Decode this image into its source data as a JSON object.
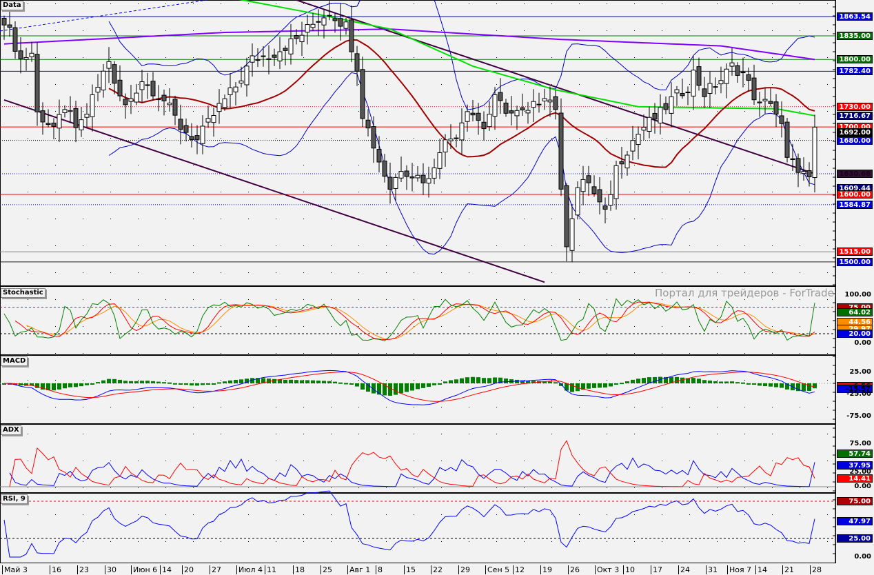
{
  "panels": {
    "main": "Data",
    "stochastic": "Stochastic",
    "macd": "MACD",
    "adx": "ADX",
    "rsi": "RSI, 9"
  },
  "watermark": "Портал для трейдеров - ForTrader.ru",
  "x_labels": [
    "Май 3",
    "16",
    "23",
    "30",
    "Июн 6",
    "14",
    "20",
    "27",
    "Июл 4",
    "11",
    "18",
    "25",
    "Авг 1",
    "8",
    "15",
    "22",
    "29",
    "Сен 5",
    "12",
    "19",
    "26",
    "Окт 3",
    "10",
    "17",
    "24",
    "31",
    "Ноя 7",
    "14",
    "21",
    "28"
  ],
  "price_levels": [
    {
      "label": "1863.54",
      "value": 1863.54,
      "bg": "#0000e0",
      "fg": "#ffffff",
      "line": "#0000e0",
      "style": "solid"
    },
    {
      "label": "1835.00",
      "value": 1835.0,
      "bg": "#007000",
      "fg": "#ffffff",
      "line": "#008000",
      "style": "solid"
    },
    {
      "label": "1800.00",
      "value": 1800.0,
      "bg": "#007000",
      "fg": "#ffffff",
      "line": "#008000",
      "style": "solid"
    },
    {
      "label": "1782.40",
      "value": 1782.4,
      "bg": "#0000e0",
      "fg": "#ffffff",
      "line": "#202040",
      "style": "solid"
    },
    {
      "label": "1730.00",
      "value": 1730.0,
      "bg": "#ff0000",
      "fg": "#ffffff",
      "line": "#ff0000",
      "style": "dotted"
    },
    {
      "label": "1716.67",
      "value": 1716.67,
      "bg": "#000080",
      "fg": "#ffffff",
      "line": null,
      "style": "none"
    },
    {
      "label": "1700.00",
      "value": 1700.0,
      "bg": "#ff0000",
      "fg": "#ffffff",
      "line": "#ff0000",
      "style": "solid"
    },
    {
      "label": "1692.00",
      "value": 1692.0,
      "bg": "#000000",
      "fg": "#ffffff",
      "line": null,
      "style": "none"
    },
    {
      "label": "1680.00",
      "value": 1680.0,
      "bg": "#0000e0",
      "fg": "#ffffff",
      "line": "#000000",
      "style": "dotted"
    },
    {
      "label": "1630.68",
      "value": 1630.68,
      "bg": "#301030",
      "fg": "#1a001a",
      "line": "#0000e0",
      "style": "dotted"
    },
    {
      "label": "1609.44",
      "value": 1609.44,
      "bg": "#000080",
      "fg": "#ffffff",
      "line": null,
      "style": "none"
    },
    {
      "label": "1600.00",
      "value": 1600.0,
      "bg": "#ff0000",
      "fg": "#ffffff",
      "line": "#ff0000",
      "style": "solid"
    },
    {
      "label": "1584.87",
      "value": 1584.87,
      "bg": "#0000e0",
      "fg": "#ffffff",
      "line": "#0000e0",
      "style": "dotted"
    },
    {
      "label": "1515.00",
      "value": 1515.0,
      "bg": "#ff0000",
      "fg": "#ffffff",
      "line": "#808080",
      "style": "solid"
    },
    {
      "label": "1500.00",
      "value": 1500.0,
      "bg": "#0000e0",
      "fg": "#ffffff",
      "line": "#202020",
      "style": "solid"
    }
  ],
  "stoch_labels": [
    {
      "label": "100.00",
      "value": 100,
      "bg": "",
      "fg": "#000"
    },
    {
      "label": "75.00",
      "value": 75,
      "bg": "#b00000",
      "fg": "#fff"
    },
    {
      "label": "64.02",
      "value": 64.02,
      "bg": "#007000",
      "fg": "#fff"
    },
    {
      "label": "44.56",
      "value": 44.56,
      "bg": "#ff8c00",
      "fg": "#fff"
    },
    {
      "label": "29.97",
      "value": 29.97,
      "bg": "#ff8c00",
      "fg": "#fff"
    },
    {
      "label": "20.00",
      "value": 20,
      "bg": "#0000e0",
      "fg": "#fff"
    },
    {
      "label": "0.00",
      "value": 0,
      "bg": "",
      "fg": "#000"
    }
  ],
  "macd_labels": [
    {
      "label": "25.00",
      "value": 25,
      "bg": "",
      "fg": "#000"
    },
    {
      "label": "-6.56",
      "value": -6.56,
      "bg": "#ff0000",
      "fg": "#000"
    },
    {
      "label": "-15.57",
      "value": -12,
      "bg": "#0000e0",
      "fg": "#000"
    },
    {
      "label": "-25.00",
      "value": -25,
      "bg": "",
      "fg": "#000"
    },
    {
      "label": "-75.00",
      "value": -75,
      "bg": "",
      "fg": "#000"
    }
  ],
  "adx_labels": [
    {
      "label": "75.00",
      "value": 75,
      "bg": "",
      "fg": "#000"
    },
    {
      "label": "57.74",
      "value": 57.74,
      "bg": "#007000",
      "fg": "#fff"
    },
    {
      "label": "37.95",
      "value": 37.95,
      "bg": "#0000e0",
      "fg": "#fff"
    },
    {
      "label": "25.00",
      "value": 25,
      "bg": "",
      "fg": "#000"
    },
    {
      "label": "14.41",
      "value": 14.41,
      "bg": "#ff0000",
      "fg": "#fff"
    },
    {
      "label": "0.00",
      "value": 0,
      "bg": "",
      "fg": "#000"
    }
  ],
  "rsi_labels": [
    {
      "label": "75.00",
      "value": 75,
      "bg": "#b00000",
      "fg": "#fff"
    },
    {
      "label": "47.97",
      "value": 47.97,
      "bg": "#0000e0",
      "fg": "#fff"
    },
    {
      "label": "25.00",
      "value": 25,
      "bg": "#0000a0",
      "fg": "#fff"
    },
    {
      "label": "0.00",
      "value": 0,
      "bg": "",
      "fg": "#000"
    }
  ],
  "chart_data": {
    "type": "candlestick",
    "bars": 148,
    "close_keypoints": [
      [
        0,
        1860
      ],
      [
        3,
        1800
      ],
      [
        5,
        1810
      ],
      [
        6,
        1720
      ],
      [
        9,
        1700
      ],
      [
        12,
        1730
      ],
      [
        13,
        1690
      ],
      [
        15,
        1720
      ],
      [
        19,
        1800
      ],
      [
        20,
        1760
      ],
      [
        22,
        1730
      ],
      [
        25,
        1770
      ],
      [
        29,
        1740
      ],
      [
        32,
        1700
      ],
      [
        35,
        1680
      ],
      [
        39,
        1730
      ],
      [
        42,
        1760
      ],
      [
        45,
        1800
      ],
      [
        49,
        1810
      ],
      [
        53,
        1830
      ],
      [
        57,
        1860
      ],
      [
        59,
        1870
      ],
      [
        62,
        1850
      ],
      [
        64,
        1790
      ],
      [
        65,
        1720
      ],
      [
        68,
        1650
      ],
      [
        70,
        1610
      ],
      [
        72,
        1640
      ],
      [
        74,
        1630
      ],
      [
        77,
        1620
      ],
      [
        79,
        1670
      ],
      [
        82,
        1690
      ],
      [
        84,
        1730
      ],
      [
        87,
        1700
      ],
      [
        89,
        1740
      ],
      [
        92,
        1720
      ],
      [
        95,
        1720
      ],
      [
        98,
        1750
      ],
      [
        100,
        1730
      ],
      [
        101,
        1600
      ],
      [
        102,
        1530
      ],
      [
        104,
        1610
      ],
      [
        106,
        1620
      ],
      [
        107,
        1600
      ],
      [
        109,
        1570
      ],
      [
        111,
        1640
      ],
      [
        114,
        1680
      ],
      [
        116,
        1700
      ],
      [
        119,
        1720
      ],
      [
        121,
        1740
      ],
      [
        124,
        1760
      ],
      [
        125,
        1780
      ],
      [
        127,
        1750
      ],
      [
        130,
        1770
      ],
      [
        132,
        1790
      ],
      [
        134,
        1780
      ],
      [
        137,
        1730
      ],
      [
        139,
        1740
      ],
      [
        141,
        1700
      ],
      [
        142,
        1650
      ],
      [
        144,
        1640
      ],
      [
        146,
        1620
      ],
      [
        147,
        1692
      ]
    ],
    "ma_long_purple": [
      [
        0,
        1823
      ],
      [
        40,
        1840
      ],
      [
        70,
        1845
      ],
      [
        100,
        1830
      ],
      [
        130,
        1820
      ],
      [
        147,
        1800
      ]
    ],
    "ma_mid_green": [
      [
        42,
        1890
      ],
      [
        55,
        1870
      ],
      [
        70,
        1845
      ],
      [
        85,
        1790
      ],
      [
        100,
        1755
      ],
      [
        115,
        1730
      ],
      [
        130,
        1728
      ],
      [
        140,
        1727
      ],
      [
        147,
        1716.67
      ]
    ],
    "trendlines": [
      {
        "from": [
          0,
          1740
        ],
        "to": [
          98,
          1470
        ],
        "color": "#400040"
      },
      {
        "from": [
          53,
          1888
        ],
        "to": [
          147,
          1630.68
        ],
        "color": "#400040"
      }
    ],
    "indicators": [
      "SMA 20",
      "Bollinger Bands 20,2",
      "Stochastic",
      "MACD",
      "ADX",
      "RSI 9"
    ]
  }
}
